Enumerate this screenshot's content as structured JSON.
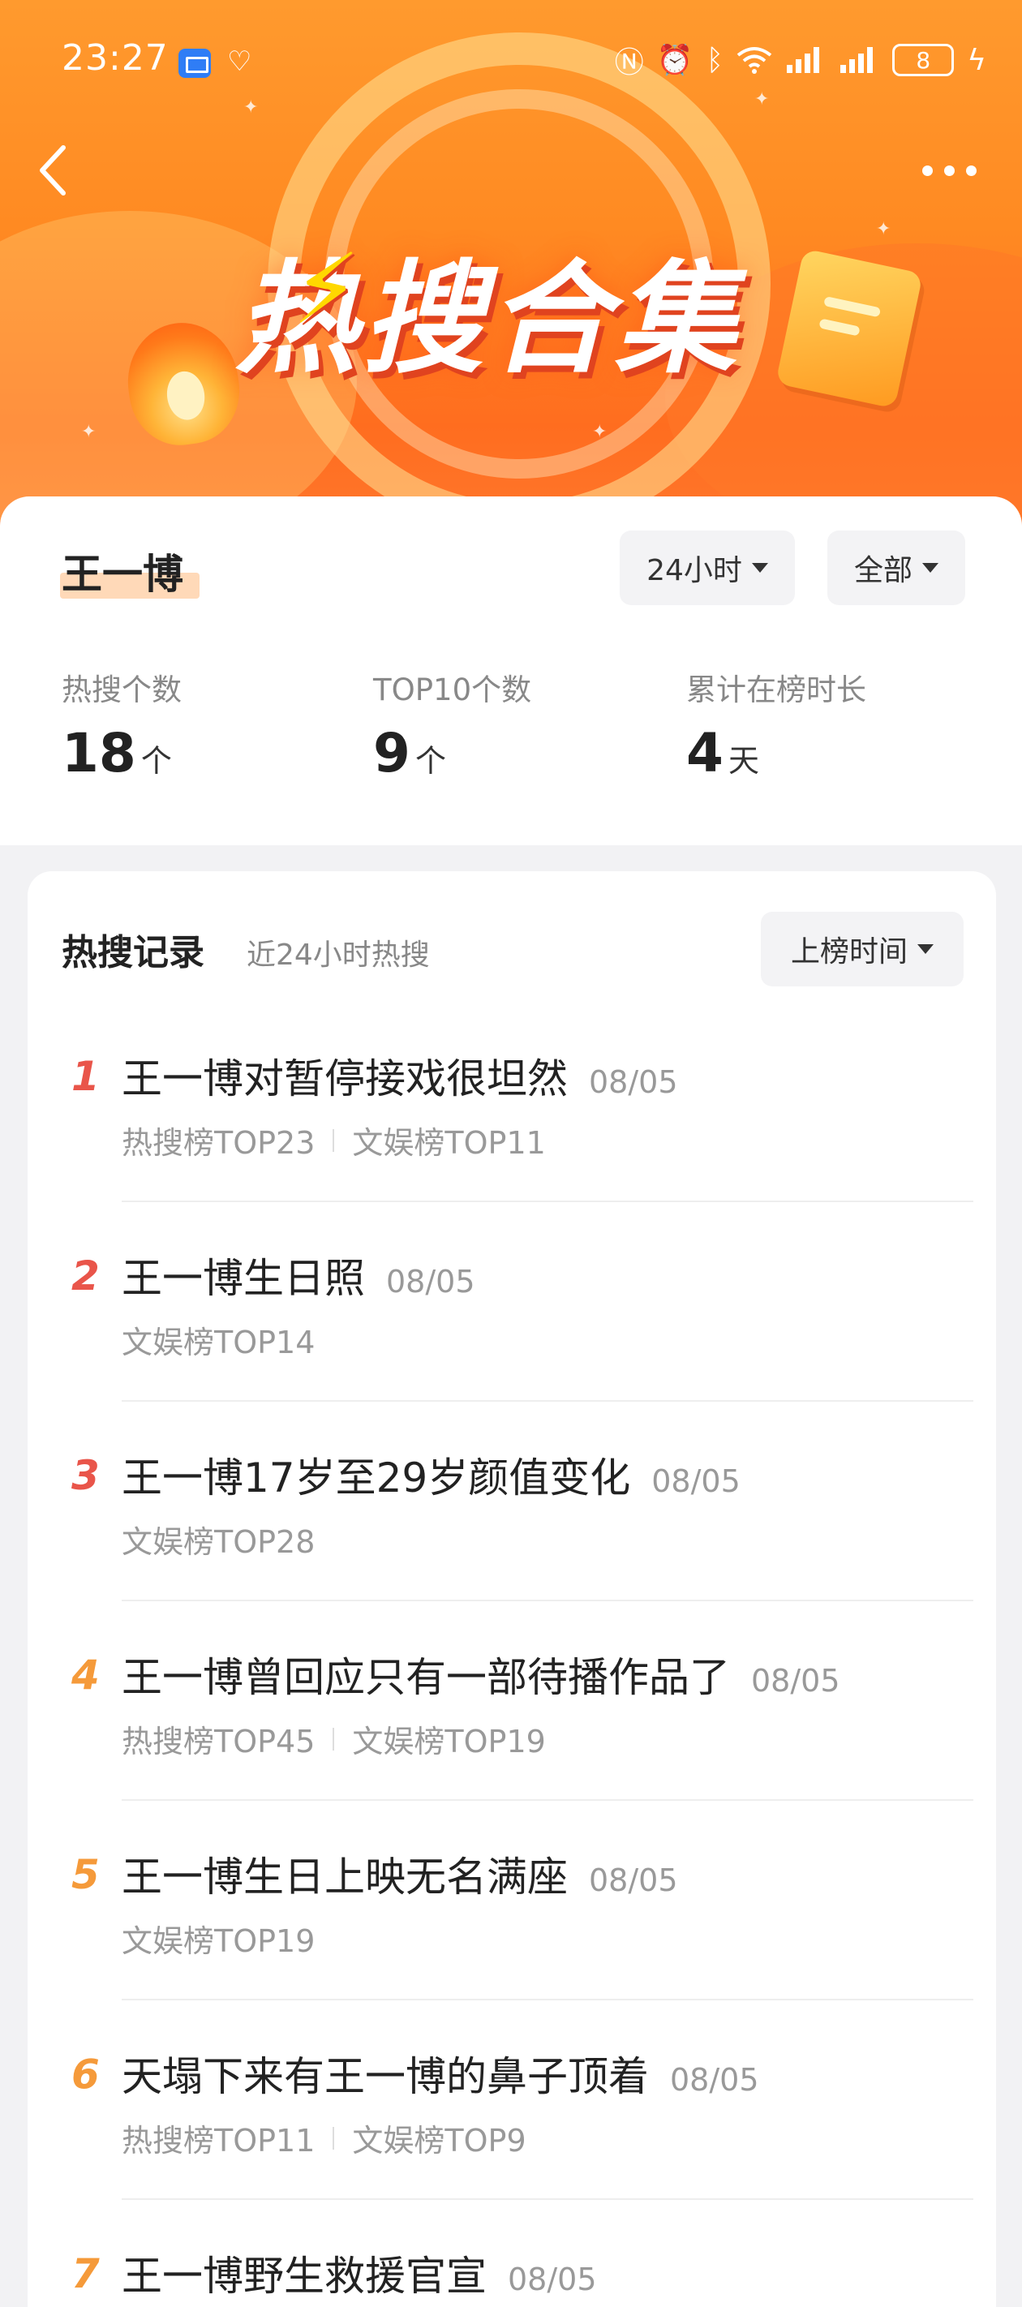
{
  "status_bar": {
    "time": "23:27",
    "battery": "8"
  },
  "banner": {
    "title": "热搜合集"
  },
  "summary": {
    "name": "王一博",
    "filter_time": "24小时",
    "filter_scope": "全部",
    "stats": [
      {
        "label": "热搜个数",
        "value": "18",
        "unit": "个"
      },
      {
        "label": "TOP10个数",
        "value": "9",
        "unit": "个"
      },
      {
        "label": "累计在榜时长",
        "value": "4",
        "unit": "天"
      }
    ]
  },
  "records": {
    "title": "热搜记录",
    "subtitle": "近24小时热搜",
    "sort_label": "上榜时间",
    "items": [
      {
        "rank": "1",
        "title": "王一博对暂停接戏很坦然",
        "date": "08/05",
        "tags": [
          "热搜榜TOP23",
          "文娱榜TOP11"
        ]
      },
      {
        "rank": "2",
        "title": "王一博生日照",
        "date": "08/05",
        "tags": [
          "文娱榜TOP14"
        ]
      },
      {
        "rank": "3",
        "title": "王一博17岁至29岁颜值变化",
        "date": "08/05",
        "tags": [
          "文娱榜TOP28"
        ]
      },
      {
        "rank": "4",
        "title": "王一博曾回应只有一部待播作品了",
        "date": "08/05",
        "tags": [
          "热搜榜TOP45",
          "文娱榜TOP19"
        ]
      },
      {
        "rank": "5",
        "title": "王一博生日上映无名满座",
        "date": "08/05",
        "tags": [
          "文娱榜TOP19"
        ]
      },
      {
        "rank": "6",
        "title": "天塌下来有王一博的鼻子顶着",
        "date": "08/05",
        "tags": [
          "热搜榜TOP11",
          "文娱榜TOP9"
        ]
      },
      {
        "rank": "7",
        "title": "王一博野生救援官宣",
        "date": "08/05",
        "tags": []
      }
    ]
  },
  "colors": {
    "rank_top3": "#e9554a",
    "rank_other": "#f59a3a",
    "banner": "#ff8a22"
  }
}
